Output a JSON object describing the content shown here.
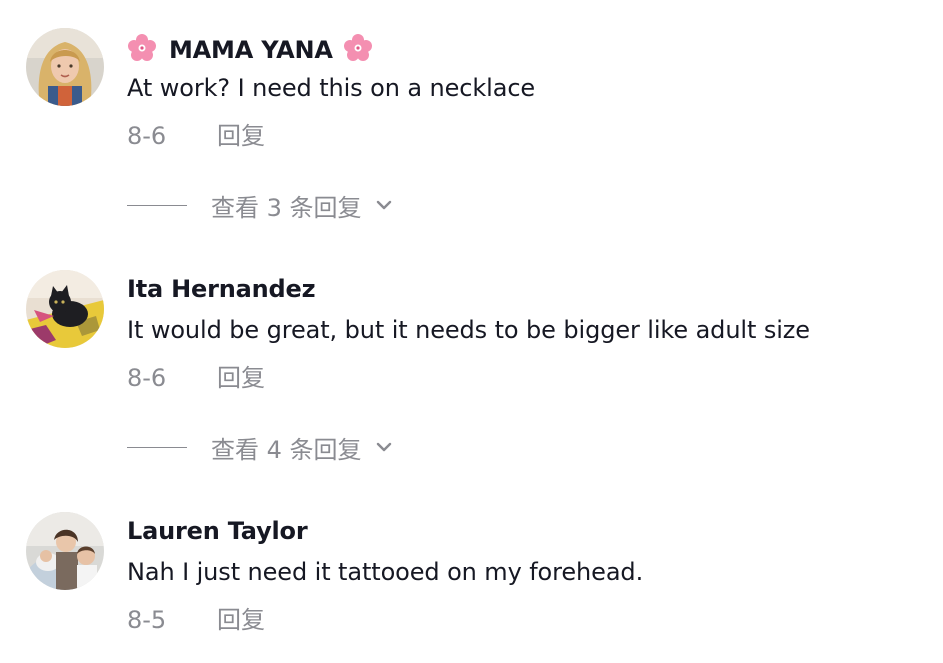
{
  "comments": [
    {
      "username": "MAMA YANA",
      "text": "At work? I need this on a necklace",
      "date": "8-6",
      "reply_label": "回复",
      "view_replies_label": "查看 3 条回复",
      "avatar_icon": "avatar-blonde-woman"
    },
    {
      "username": "Ita Hernandez",
      "text": "It would be great, but it needs to be bigger like adult size",
      "date": "8-6",
      "reply_label": "回复",
      "view_replies_label": "查看 4 条回复",
      "avatar_icon": "avatar-black-cat"
    },
    {
      "username": "Lauren Taylor",
      "text": "Nah I just need it tattooed on my forehead.",
      "date": "8-5",
      "reply_label": "回复",
      "avatar_icon": "avatar-mother-children"
    }
  ],
  "colors": {
    "primary_text": "#161823",
    "secondary_text": "#8a8b91",
    "flower": "#f48fb1"
  },
  "icons": {
    "name_decoration": "cherry-blossom-icon",
    "expand": "chevron-down-icon"
  }
}
